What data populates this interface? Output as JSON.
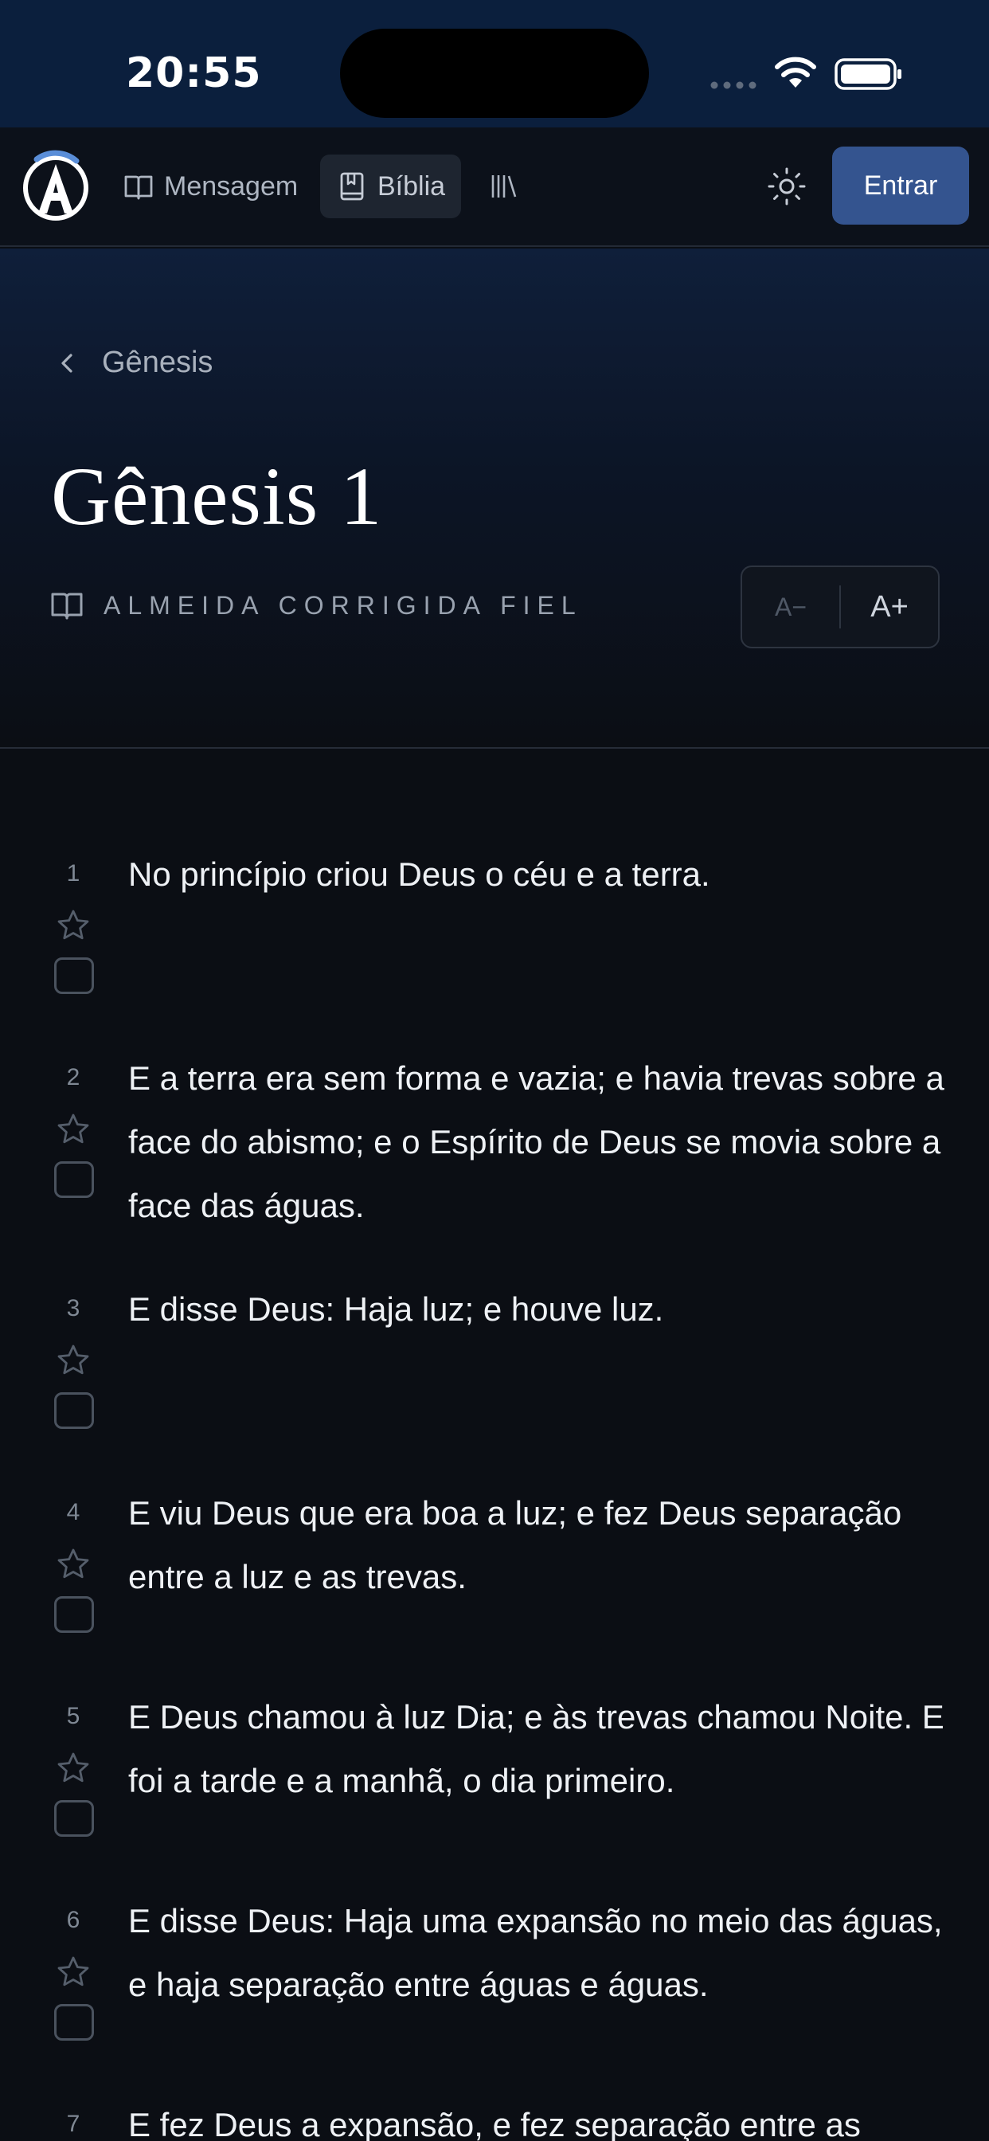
{
  "status_bar": {
    "time": "20:55"
  },
  "nav": {
    "items": [
      {
        "label": "Mensagem"
      },
      {
        "label": "Bíblia"
      }
    ],
    "login_label": "Entrar"
  },
  "header": {
    "breadcrumb": "Gênesis",
    "title": "Gênesis 1",
    "version": "ALMEIDA CORRIGIDA FIEL",
    "font_decrease": "A−",
    "font_increase": "A+"
  },
  "verses": [
    {
      "number": "1",
      "text": "No princípio criou Deus o céu e a terra."
    },
    {
      "number": "2",
      "text": "E a terra era sem forma e vazia; e havia trevas sobre a face do abismo; e o Espírito de Deus se movia sobre a face das águas."
    },
    {
      "number": "3",
      "text": "E disse Deus: Haja luz; e houve luz."
    },
    {
      "number": "4",
      "text": "E viu Deus que era boa a luz; e fez Deus separação entre a luz e as trevas."
    },
    {
      "number": "5",
      "text": "E Deus chamou à luz Dia; e às trevas chamou Noite. E foi a tarde e a manhã, o dia primeiro."
    },
    {
      "number": "6",
      "text": "E disse Deus: Haja uma expansão no meio das águas, e haja separação entre águas e águas."
    },
    {
      "number": "7",
      "text": "E fez Deus a expansão, e fez separação entre as"
    }
  ]
}
